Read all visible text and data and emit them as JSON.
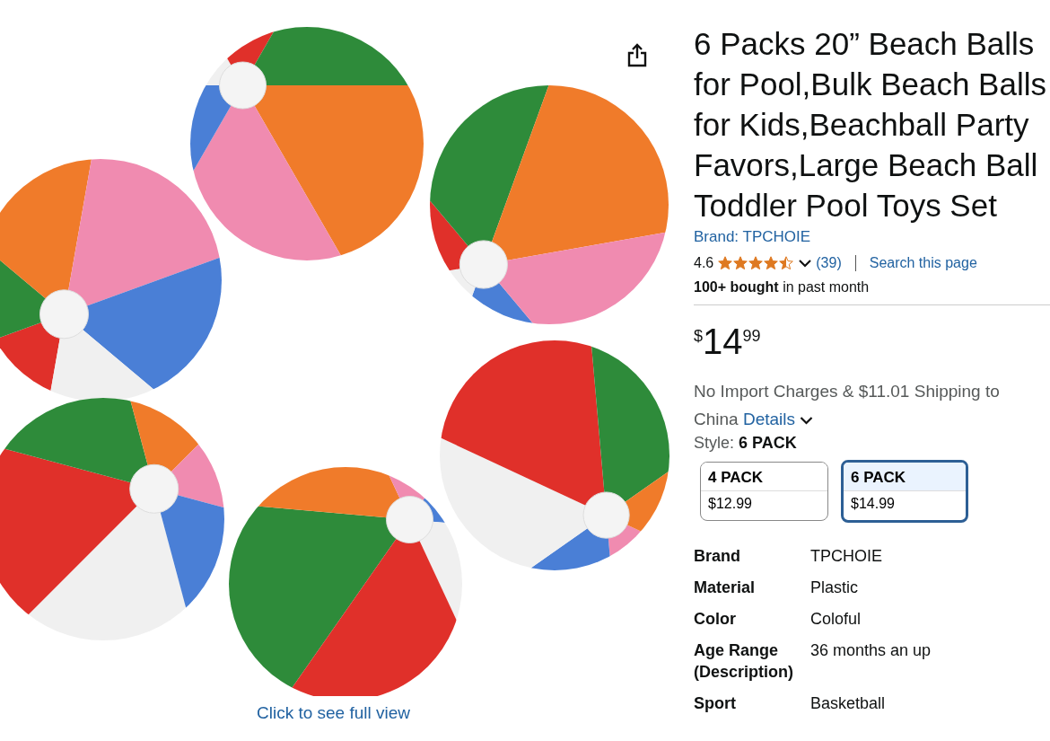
{
  "product_image": {
    "caption": "Click to see full view"
  },
  "title": "6 Packs 20” Beach Balls for Pool,Bulk Beach Balls for Kids,Beachball Party Favors,Large Beach Ball Toddler Pool Toys Set",
  "brand_link": "Brand: TPCHOIE",
  "rating": {
    "value": "4.6",
    "stars": 4.5,
    "count": "(39)",
    "search_link": "Search this page"
  },
  "bought": "**100+ bought** in past month",
  "price": {
    "currency": "$",
    "whole": "14",
    "fraction": "99"
  },
  "shipping": {
    "text": "No Import Charges & $11.01 Shipping to China",
    "details_link": "Details"
  },
  "style": {
    "label": "Style: **6 PACK**",
    "options": [
      {
        "name": "4 PACK",
        "price": "$12.99",
        "selected": false
      },
      {
        "name": "6 PACK",
        "price": "$14.99",
        "selected": true
      }
    ]
  },
  "specs": [
    {
      "name": "Brand",
      "value": "TPCHOIE"
    },
    {
      "name": "Material",
      "value": "Plastic"
    },
    {
      "name": "Color",
      "value": "Coloful"
    },
    {
      "name": "Age Range (Description)",
      "value": "36 months an up"
    },
    {
      "name": "Sport",
      "value": "Basketball"
    }
  ]
}
